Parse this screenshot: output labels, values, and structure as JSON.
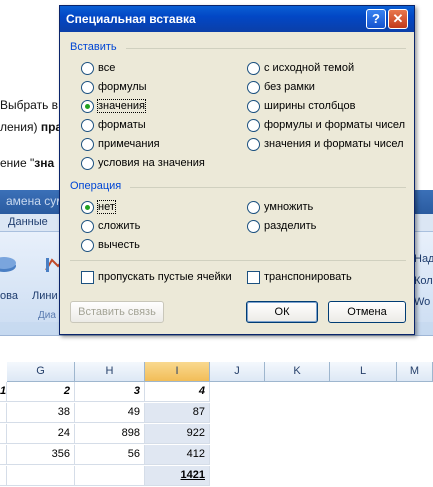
{
  "background": {
    "line1": "Выбрать в",
    "line2_prefix": "ления) ",
    "line2_bold": "пра",
    "line3_prefix": "ение \"",
    "line3_bold": "зна",
    "ribbon_title": "амена сумм",
    "tab_data": "Данные",
    "btn_left": "ова",
    "btn_line": "Лини",
    "group_label": "Диа",
    "right_1": "Над",
    "right_2": "Кол",
    "right_3": "Wo"
  },
  "dialog": {
    "title": "Специальная вставка",
    "help_label": "?",
    "close_label": "✕",
    "paste_section": "Вставить",
    "paste_left": [
      {
        "label": "все",
        "selected": false
      },
      {
        "label": "формулы",
        "selected": false
      },
      {
        "label": "значения",
        "selected": true
      },
      {
        "label": "форматы",
        "selected": false
      },
      {
        "label": "примечания",
        "selected": false
      },
      {
        "label": "условия на значения",
        "selected": false
      }
    ],
    "paste_right": [
      {
        "label": "с исходной темой",
        "selected": false
      },
      {
        "label": "без рамки",
        "selected": false
      },
      {
        "label": "ширины столбцов",
        "selected": false
      },
      {
        "label": "формулы и форматы чисел",
        "selected": false
      },
      {
        "label": "значения и форматы чисел",
        "selected": false
      }
    ],
    "operation_section": "Операция",
    "op_left": [
      {
        "label": "нет",
        "selected": true
      },
      {
        "label": "сложить",
        "selected": false
      },
      {
        "label": "вычесть",
        "selected": false
      }
    ],
    "op_right": [
      {
        "label": "умножить",
        "selected": false
      },
      {
        "label": "разделить",
        "selected": false
      }
    ],
    "skip_blanks": {
      "label": "пропускать пустые ячейки",
      "checked": false
    },
    "transpose": {
      "label": "транспонировать",
      "checked": false
    },
    "paste_link_button": "Вставить связь",
    "ok_button": "ОК",
    "cancel_button": "Отмена"
  },
  "sheet": {
    "columns": [
      "G",
      "H",
      "I",
      "J",
      "K",
      "L",
      "M"
    ],
    "selected_column": "I",
    "rows": [
      [
        "1",
        "2",
        "3",
        "4"
      ],
      [
        "",
        "38",
        "49",
        "87"
      ],
      [
        "",
        "24",
        "898",
        "922"
      ],
      [
        "",
        "356",
        "56",
        "412"
      ],
      [
        "",
        "",
        "",
        "1421"
      ]
    ]
  }
}
